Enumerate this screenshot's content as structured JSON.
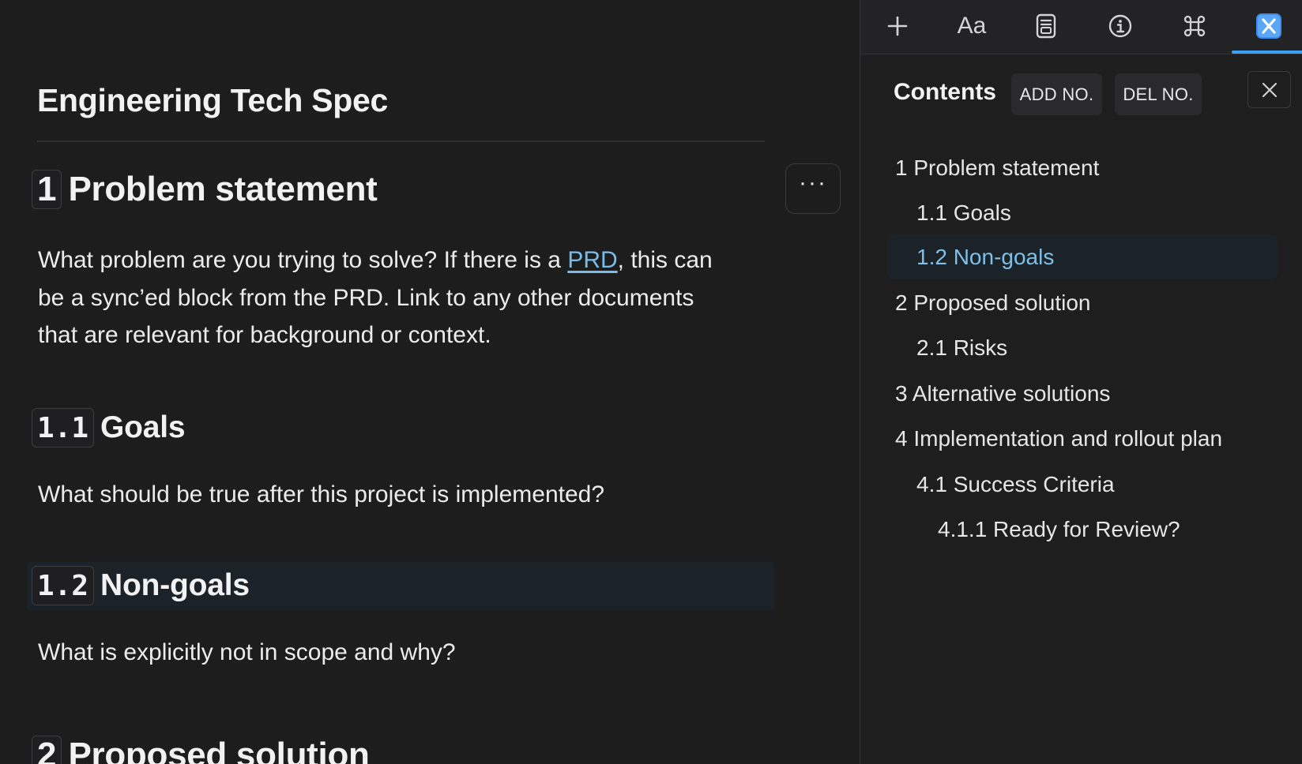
{
  "editor": {
    "title": "Engineering Tech Spec",
    "more_label": "···",
    "sections": {
      "s1": {
        "number": "1",
        "title": "Problem statement",
        "body_before_link": "What problem are you trying to solve? If there is a ",
        "link_text": "PRD",
        "body_after_link": ", this can be a sync’ed block from the PRD. Link to any other documents that are relevant for background or context."
      },
      "s1_1": {
        "number": "1.1",
        "title": "Goals",
        "body": "What should be true after this project is implemented?"
      },
      "s1_2": {
        "number": "1.2",
        "title": "Non-goals",
        "body": "What is explicitly not in scope and why?"
      },
      "s2": {
        "number": "2",
        "title": "Proposed solution"
      }
    }
  },
  "panel": {
    "toolbar": {
      "items": [
        {
          "icon": "plus-icon"
        },
        {
          "label": "Aa",
          "icon": "font-icon"
        },
        {
          "icon": "document-icon"
        },
        {
          "icon": "info-icon"
        },
        {
          "icon": "command-icon"
        },
        {
          "icon": "app-close-icon",
          "active": true
        }
      ]
    },
    "contents_label": "Contents",
    "add_numbers_label": "ADD NO.",
    "delete_numbers_label": "DEL NO.",
    "toc": [
      {
        "label": "1 Problem statement",
        "level": 1
      },
      {
        "label": "1.1 Goals",
        "level": 2
      },
      {
        "label": "1.2 Non-goals",
        "level": 2,
        "active": true
      },
      {
        "label": "2 Proposed solution",
        "level": 1
      },
      {
        "label": "2.1 Risks",
        "level": 2
      },
      {
        "label": "3 Alternative solutions",
        "level": 1
      },
      {
        "label": "4 Implementation and rollout plan",
        "level": 1
      },
      {
        "label": "4.1 Success Criteria",
        "level": 2
      },
      {
        "label": "4.1.1 Ready for Review?",
        "level": 3
      }
    ]
  },
  "colors": {
    "background": "#1d1d1e",
    "accent": "#3aa0f2",
    "link": "#78bde8",
    "active_row": "#1c2328"
  }
}
